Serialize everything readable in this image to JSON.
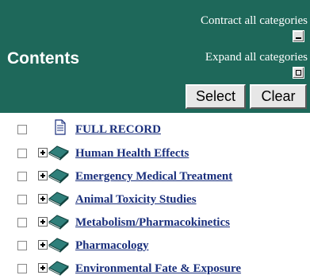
{
  "header": {
    "title": "Contents",
    "contract_label": "Contract all categories",
    "expand_label": "Expand all categories",
    "select_button": "Select",
    "clear_button": "Clear"
  },
  "tree": {
    "items": [
      {
        "label": "FULL RECORD",
        "icon": "document-icon",
        "expandable": false
      },
      {
        "label": "Human Health Effects",
        "icon": "book-icon",
        "expandable": true
      },
      {
        "label": "Emergency Medical Treatment",
        "icon": "book-icon",
        "expandable": true
      },
      {
        "label": "Animal Toxicity Studies",
        "icon": "book-icon",
        "expandable": true
      },
      {
        "label": "Metabolism/Pharmacokinetics",
        "icon": "book-icon",
        "expandable": true
      },
      {
        "label": "Pharmacology",
        "icon": "book-icon",
        "expandable": true
      },
      {
        "label": "Environmental Fate & Exposure",
        "icon": "book-icon",
        "expandable": true
      }
    ]
  },
  "colors": {
    "header_bg": "#1e685a",
    "link": "#1a2f7c"
  }
}
